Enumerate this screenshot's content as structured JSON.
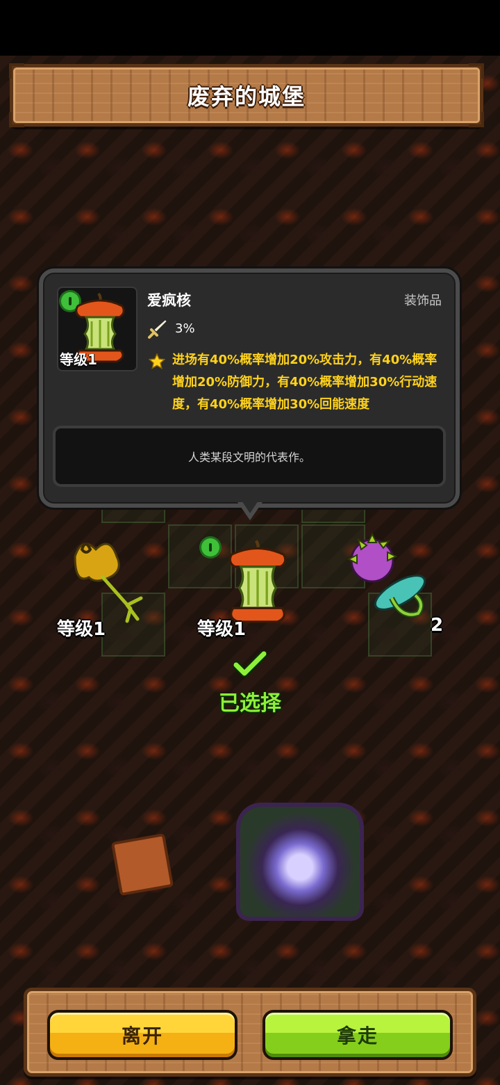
{
  "header": {
    "title": "废弃的城堡"
  },
  "popup": {
    "item_name": "爱疯核",
    "item_type": "装饰品",
    "level_label": "等级1",
    "stat_value": "3%",
    "effect_text": "进场有40%概率增加20%攻击力，有40%概率增加20%防御力，有40%概率增加30%行动速度，有40%概率增加30%回能速度",
    "description": "人类某段文明的代表作。"
  },
  "choices": [
    {
      "level_label": "等级1",
      "icon": "golden-root-icon"
    },
    {
      "level_label": "等级1",
      "icon": "apple-core-icon",
      "selected": true
    },
    {
      "level_label": "2",
      "icon": "spiked-mace-icon"
    }
  ],
  "selection": {
    "label": "已选择"
  },
  "buttons": {
    "leave": "离开",
    "take": "拿走"
  },
  "colors": {
    "selected": "#8ef03a",
    "effect": "#ffd21c",
    "leave_button": "#f5b013",
    "take_button": "#85cf1c"
  }
}
